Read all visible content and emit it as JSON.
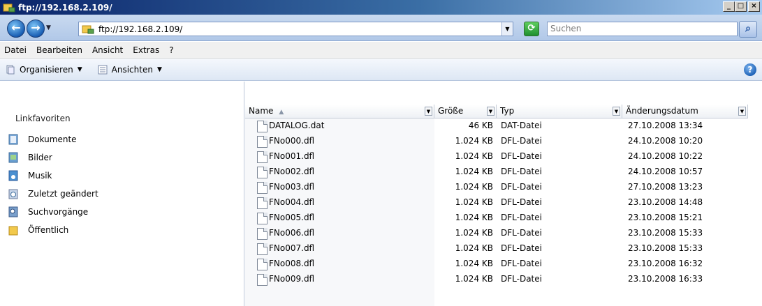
{
  "window": {
    "title": "ftp://192.168.2.109/"
  },
  "address": {
    "value": "ftp://192.168.2.109/"
  },
  "search": {
    "placeholder": "Suchen"
  },
  "menu": [
    "Datei",
    "Bearbeiten",
    "Ansicht",
    "Extras",
    "?"
  ],
  "toolbar": {
    "organize": "Organisieren",
    "views": "Ansichten"
  },
  "sidebar": {
    "header": "Linkfavoriten",
    "items": [
      "Dokumente",
      "Bilder",
      "Musik",
      "Zuletzt geändert",
      "Suchvorgänge",
      "Öffentlich"
    ]
  },
  "columns": {
    "name": "Name",
    "size": "Größe",
    "type": "Typ",
    "date": "Änderungsdatum"
  },
  "files": [
    {
      "name": "DATALOG.dat",
      "size": "46 KB",
      "type": "DAT-Datei",
      "date": "27.10.2008 13:34"
    },
    {
      "name": "FNo000.dfl",
      "size": "1.024 KB",
      "type": "DFL-Datei",
      "date": "24.10.2008 10:20"
    },
    {
      "name": "FNo001.dfl",
      "size": "1.024 KB",
      "type": "DFL-Datei",
      "date": "24.10.2008 10:22"
    },
    {
      "name": "FNo002.dfl",
      "size": "1.024 KB",
      "type": "DFL-Datei",
      "date": "24.10.2008 10:57"
    },
    {
      "name": "FNo003.dfl",
      "size": "1.024 KB",
      "type": "DFL-Datei",
      "date": "27.10.2008 13:23"
    },
    {
      "name": "FNo004.dfl",
      "size": "1.024 KB",
      "type": "DFL-Datei",
      "date": "23.10.2008 14:48"
    },
    {
      "name": "FNo005.dfl",
      "size": "1.024 KB",
      "type": "DFL-Datei",
      "date": "23.10.2008 15:21"
    },
    {
      "name": "FNo006.dfl",
      "size": "1.024 KB",
      "type": "DFL-Datei",
      "date": "23.10.2008 15:33"
    },
    {
      "name": "FNo007.dfl",
      "size": "1.024 KB",
      "type": "DFL-Datei",
      "date": "23.10.2008 15:33"
    },
    {
      "name": "FNo008.dfl",
      "size": "1.024 KB",
      "type": "DFL-Datei",
      "date": "23.10.2008 16:32"
    },
    {
      "name": "FNo009.dfl",
      "size": "1.024 KB",
      "type": "DFL-Datei",
      "date": "23.10.2008 16:33"
    }
  ],
  "icons": {
    "title": "network-folder-icon",
    "back": "back-arrow-icon",
    "forward": "forward-arrow-icon",
    "refresh": "refresh-icon",
    "search": "search-icon",
    "help": "help-icon",
    "organize": "organize-icon",
    "views": "views-icon",
    "file": "file-icon"
  },
  "colors": {
    "titlebar": "#0a246a",
    "addrbar": "#c9daf0",
    "toolbar": "#dde7f4"
  }
}
